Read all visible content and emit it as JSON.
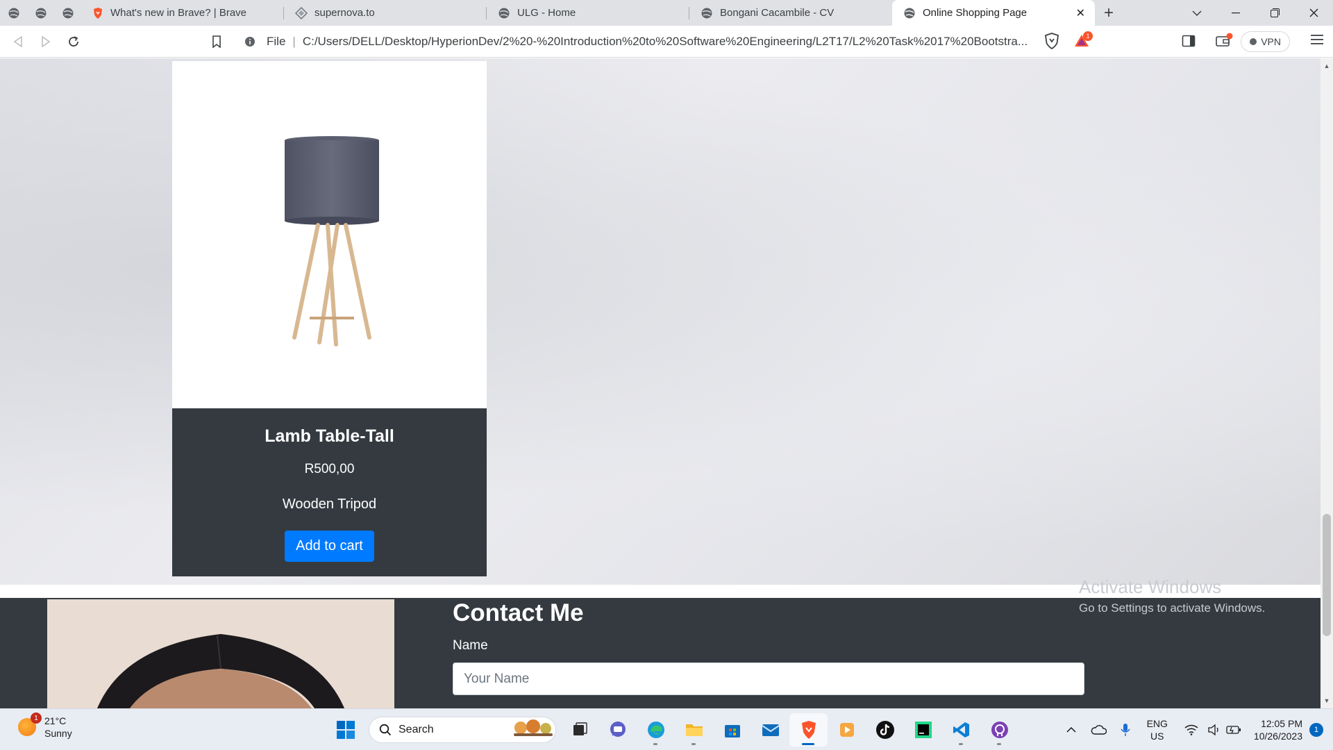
{
  "browser": {
    "tabs": [
      {
        "title": "What's new in Brave? | Brave",
        "icon": "brave-icon"
      },
      {
        "title": "supernova.to",
        "icon": "supernova-icon"
      },
      {
        "title": "ULG - Home",
        "icon": "globe-icon"
      },
      {
        "title": "Bongani Cacambile - CV",
        "icon": "globe-icon"
      },
      {
        "title": "Online Shopping Page",
        "icon": "globe-icon",
        "active": true
      }
    ],
    "address": {
      "scheme_label": "File",
      "url": "C:/Users/DELL/Desktop/HyperionDev/2%20-%20Introduction%20to%20Software%20Engineering/L2T17/L2%20Task%2017%20Bootstra..."
    },
    "vpn_label": "VPN",
    "rewards_count": "1"
  },
  "page": {
    "product": {
      "title": "Lamb Table-Tall",
      "price": "R500,00",
      "description": "Wooden Tripod",
      "button_label": "Add to cart"
    },
    "contact": {
      "heading": "Contact Me",
      "name_label": "Name",
      "name_placeholder": "Your Name"
    }
  },
  "watermark": {
    "title": "Activate Windows",
    "subtitle": "Go to Settings to activate Windows."
  },
  "taskbar": {
    "weather": {
      "temp": "21°C",
      "condition": "Sunny",
      "badge": "1"
    },
    "search_label": "Search",
    "tray": {
      "lang_top": "ENG",
      "lang_bottom": "US",
      "time": "12:05 PM",
      "date": "10/26/2023",
      "notifications": "1"
    }
  },
  "colors": {
    "card_body": "#343a40",
    "button_primary": "#007bff",
    "brave_orange": "#fb542b"
  }
}
